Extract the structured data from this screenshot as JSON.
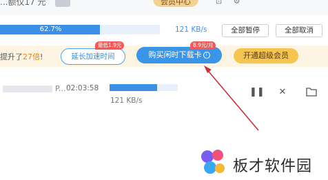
{
  "top": {
    "partial_text": "...额仅17 元",
    "member_center_label": "会员中心"
  },
  "download_summary": {
    "progress_percent": 62.7,
    "progress_label": "62.7%",
    "speed": "121 KB/s",
    "pause_all_label": "全部暂停",
    "cancel_all_label": "全部取消"
  },
  "promo": {
    "text_before": "提升了",
    "highlight": "27倍",
    "text_after": "!",
    "extend_button_label": "延长加速时间",
    "extend_badge": "最低1.9元",
    "buy_button_label": "购买闲时下载卡",
    "buy_badge": "8.9元/月",
    "vip_button_label": "开通超级会员"
  },
  "download_item": {
    "name_visible": "P...",
    "eta": "02:03:58",
    "progress_fraction": 0.7,
    "speed": "121 KB/s"
  },
  "watermark": {
    "text": "板才软件园"
  },
  "colors": {
    "accent_blue": "#3b8fe6",
    "promo_bg": "#fdf4e3",
    "badge_red": "#f05a5a",
    "vip_gold": "#f5c451",
    "arrow_red": "#c8323a"
  },
  "icons": [
    "settings-icon",
    "skin-icon",
    "pause-icon",
    "close-icon",
    "folder-icon",
    "info-icon"
  ]
}
